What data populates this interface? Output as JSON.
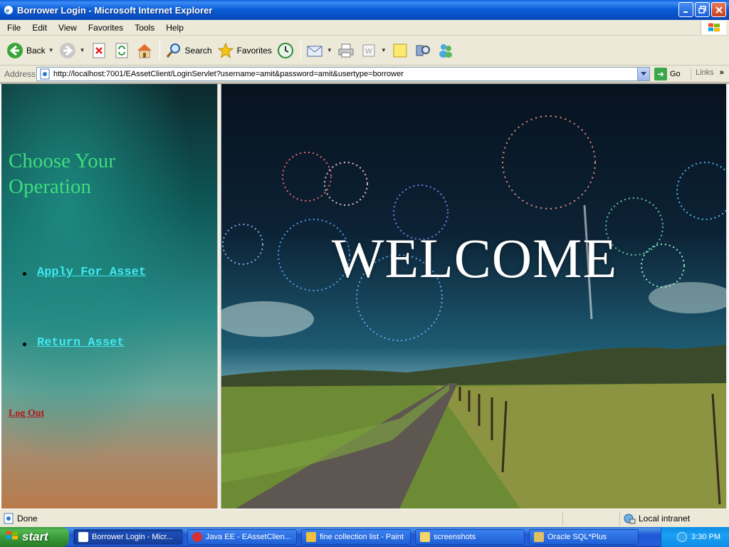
{
  "window": {
    "title": "Borrower Login - Microsoft Internet Explorer"
  },
  "menu": [
    "File",
    "Edit",
    "View",
    "Favorites",
    "Tools",
    "Help"
  ],
  "toolbar": {
    "back": "Back",
    "search": "Search",
    "favorites": "Favorites"
  },
  "address": {
    "label": "Address",
    "url": "http://localhost:7001/EAssetClient/LoginServlet?username=amit&password=amit&usertype=borrower",
    "go": "Go",
    "links": "Links"
  },
  "left_frame": {
    "heading": "Choose Your Operation",
    "items": [
      "Apply For Asset",
      "Return Asset"
    ],
    "logout": "Log Out"
  },
  "right_frame": {
    "banner": "WELCOME"
  },
  "status": {
    "text": "Done",
    "zone": "Local intranet"
  },
  "taskbar": {
    "start": "start",
    "tasks": [
      "Borrower Login - Micr...",
      "Java EE - EAssetClien...",
      "fine collection list - Paint",
      "screenshots",
      "Oracle SQL*Plus"
    ],
    "clock": "3:30 PM"
  },
  "colors": {
    "heading": "#3fdc7e",
    "link": "#40e8f0",
    "logout": "#b3161d",
    "xp_blue": "#245edb"
  }
}
